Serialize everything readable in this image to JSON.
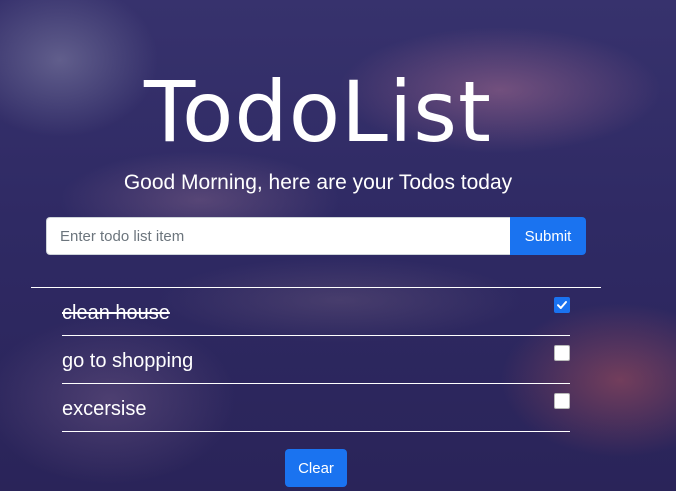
{
  "header": {
    "title": "TodoList",
    "subtitle": "Good Morning, here are your Todos today"
  },
  "form": {
    "placeholder": "Enter todo list item",
    "value": "",
    "submit_label": "Submit"
  },
  "todos": [
    {
      "text": "clean house",
      "done": true
    },
    {
      "text": "go to shopping",
      "done": false
    },
    {
      "text": "excersise",
      "done": false
    }
  ],
  "actions": {
    "clear_label": "Clear"
  },
  "colors": {
    "accent": "#1a73f0",
    "overlay": "#2f2a64"
  }
}
